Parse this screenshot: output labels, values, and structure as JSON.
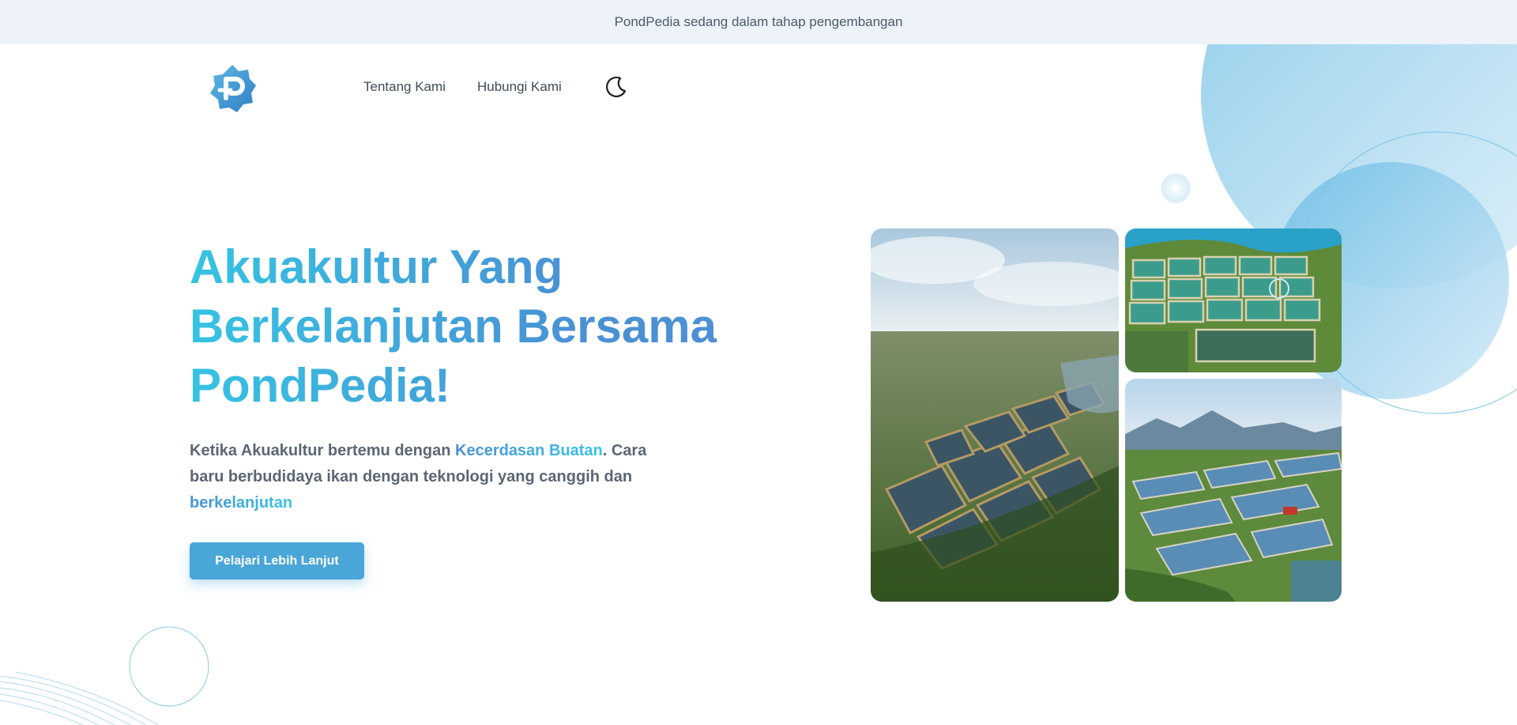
{
  "banner": {
    "text": "PondPedia sedang dalam tahap pengembangan"
  },
  "nav": {
    "logo_icon": "pondpedia-logo-icon",
    "links": [
      {
        "label": "Tentang Kami"
      },
      {
        "label": "Hubungi Kami"
      }
    ],
    "theme_toggle_icon": "moon-icon"
  },
  "hero": {
    "title_lines": [
      "Akuakultur Yang",
      "Berkelanjutan Bersama",
      "PondPedia!"
    ],
    "desc_part1": "Ketika Akuakultur bertemu dengan ",
    "desc_highlight1": "Kecerdasan Buatan",
    "desc_part2": ". Cara baru berbudidaya ikan dengan teknologi yang canggih dan ",
    "desc_highlight2": "berkelanjutan",
    "cta_label": "Pelajari Lebih Lanjut"
  },
  "gallery": {
    "images": [
      {
        "alt": "aerial-aquaculture-ponds-photo"
      },
      {
        "alt": "aerial-square-ponds-photo"
      },
      {
        "alt": "aerial-ponds-mountains-photo"
      }
    ]
  },
  "colors": {
    "banner_bg": "#eef3fa",
    "accent": "#4aa6d8",
    "gradient_start": "#36c3e3",
    "gradient_end": "#4a90d4"
  }
}
